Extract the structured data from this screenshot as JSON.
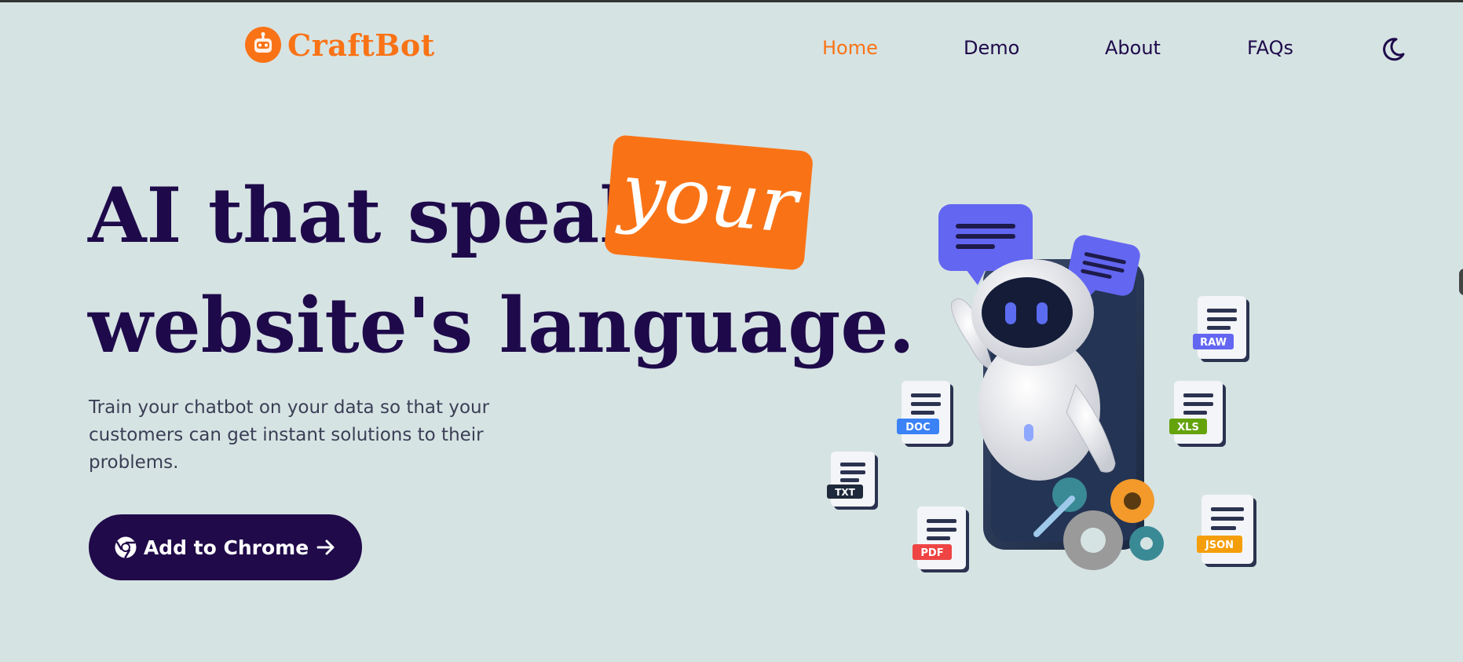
{
  "brand": {
    "name": "CraftBot",
    "color": "#f97316"
  },
  "nav": {
    "items": [
      {
        "label": "Home",
        "active": true
      },
      {
        "label": "Demo",
        "active": false
      },
      {
        "label": "About",
        "active": false
      },
      {
        "label": "FAQs",
        "active": false
      }
    ],
    "theme_icon": "moon-icon"
  },
  "hero": {
    "headline_part1": "AI that speaks",
    "headline_highlight": "your",
    "headline_part2": "website's language.",
    "subtitle": "Train your chatbot on your data so that your customers can get instant solutions to their problems.",
    "cta_label": "Add to Chrome",
    "cta_icons": [
      "chrome-icon",
      "arrow-right-icon"
    ]
  },
  "illustration": {
    "file_tags": [
      "RAW",
      "DOC",
      "XLS",
      "TXT",
      "PDF",
      "JSON"
    ]
  },
  "colors": {
    "background": "#d6e3e3",
    "primary_dark": "#200a4a",
    "accent": "#f97316"
  }
}
